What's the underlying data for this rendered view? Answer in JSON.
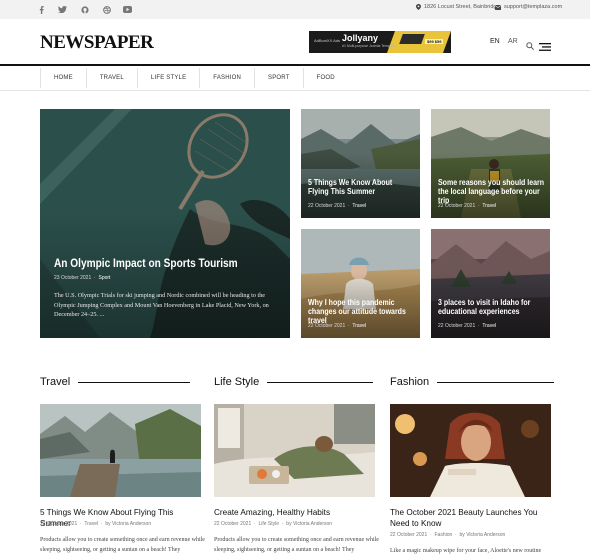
{
  "topbar": {
    "social": [
      "facebook-icon",
      "twitter-icon",
      "github-icon",
      "dribbble-icon",
      "youtube-icon"
    ],
    "address": "1826 Locust Street, Bainbridge",
    "email": "support@templaza.com"
  },
  "header": {
    "logo": "NEWSPAPER",
    "ad": {
      "left_text": "AdBoniXX Ads",
      "brand": "Jollyany",
      "tagline": "#1 Multi-purpose Joomla Template",
      "price": "$99 $59"
    },
    "lang_en": "EN",
    "lang_ar": "AR"
  },
  "nav": [
    "HOME",
    "TRAVEL",
    "LIFE STYLE",
    "FASHION",
    "SPORT",
    "FOOD"
  ],
  "hero": {
    "main": {
      "title": "An Olympic Impact on Sports Tourism",
      "date": "23 October 2021",
      "category": "Sport",
      "excerpt": "The U.S. Olympic Trials for ski jumping and Nordic combined will be heading to the Olympic Jumping Complex and Mount Van Hoevenberg in Lake Placid, New York, on December 24–25. ..."
    },
    "cards": [
      {
        "title": "5 Things We Know About Flying This Summer",
        "date": "22 October 2021",
        "category": "Travel"
      },
      {
        "title": "Some reasons you should learn the local language before your trip",
        "date": "22 October 2021",
        "category": "Travel"
      },
      {
        "title": "Why I hope this pandemic changes our attitude towards travel",
        "date": "22 October 2021",
        "category": "Travel"
      },
      {
        "title": "3 places to visit in Idaho for educational experiences",
        "date": "22 October 2021",
        "category": "Travel"
      }
    ]
  },
  "sections": [
    {
      "heading": "Travel",
      "article": {
        "title": "5 Things We Know About Flying This Summer",
        "date": "22 October 2021",
        "category": "Travel",
        "author_prefix": "by",
        "author": "Victoria Anderson",
        "excerpt": "Products allow you to create something once and earn revenue while sleeping, sightseeing, or getting a suntan on a beach! They"
      }
    },
    {
      "heading": "Life Style",
      "article": {
        "title": "Create Amazing, Healthy Habits",
        "date": "22 October 2021",
        "category": "Life Style",
        "author_prefix": "by",
        "author": "Victoria Anderson",
        "excerpt": "Products allow you to create something once and earn revenue while sleeping, sightseeing, or getting a suntan on a beach! They"
      }
    },
    {
      "heading": "Fashion",
      "article": {
        "title": "The October 2021 Beauty Launches You Need to Know",
        "date": "22 October 2021",
        "category": "Fashion",
        "author_prefix": "by",
        "author": "Victoria Anderson",
        "excerpt": "Like a magic makeup wipe for your face, Aloette's new routine"
      }
    }
  ]
}
